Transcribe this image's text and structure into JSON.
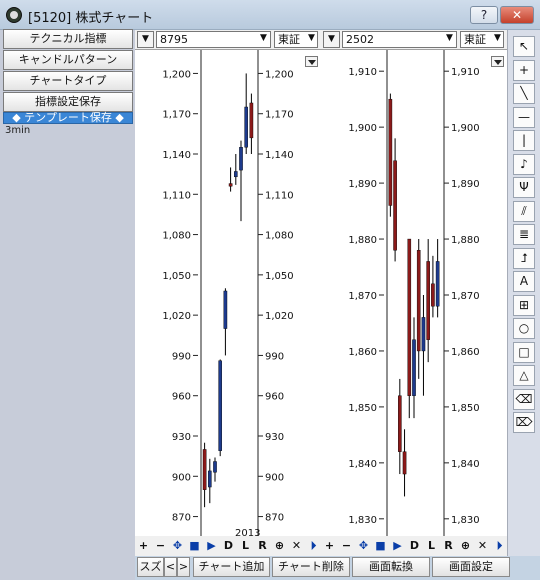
{
  "window": {
    "title": "[5120] 株式チャート",
    "help_label": "?",
    "close_label": "✕"
  },
  "left_panel": {
    "buttons": [
      "テクニカル指標",
      "キャンドルパターン",
      "チャートタイプ",
      "指標設定保存"
    ],
    "template_label": "◆ テンプレート保存 ◆",
    "interval_label": "3min"
  },
  "charts": [
    {
      "code": "8795",
      "exchange": "東証",
      "x_label": "2013",
      "y_ticks": [
        "1,200",
        "1,170",
        "1,140",
        "1,110",
        "1,080",
        "1,050",
        "1,020",
        "990",
        "960",
        "930",
        "900",
        "870"
      ],
      "ylim": [
        860,
        1210
      ],
      "candles": [
        {
          "o": 920,
          "h": 925,
          "l": 877,
          "c": 890
        },
        {
          "o": 892,
          "h": 913,
          "l": 880,
          "c": 904
        },
        {
          "o": 903,
          "h": 914,
          "l": 896,
          "c": 911
        },
        {
          "o": 919,
          "h": 987,
          "l": 915,
          "c": 986
        },
        {
          "o": 1010,
          "h": 1040,
          "l": 990,
          "c": 1038
        },
        {
          "o": 1118,
          "h": 1130,
          "l": 1112,
          "c": 1116
        },
        {
          "o": 1123,
          "h": 1140,
          "l": 1117,
          "c": 1127
        },
        {
          "o": 1128,
          "h": 1150,
          "l": 1090,
          "c": 1145
        },
        {
          "o": 1145,
          "h": 1200,
          "l": 1140,
          "c": 1175
        },
        {
          "o": 1178,
          "h": 1185,
          "l": 1140,
          "c": 1152
        }
      ]
    },
    {
      "code": "2502",
      "exchange": "東証",
      "y_ticks": [
        "1,910",
        "1,900",
        "1,890",
        "1,880",
        "1,870",
        "1,860",
        "1,850",
        "1,840",
        "1,830"
      ],
      "ylim": [
        1828,
        1912
      ],
      "candles": [
        {
          "o": 1905,
          "h": 1906,
          "l": 1884,
          "c": 1886
        },
        {
          "o": 1894,
          "h": 1898,
          "l": 1876,
          "c": 1878
        },
        {
          "o": 1852,
          "h": 1855,
          "l": 1838,
          "c": 1842
        },
        {
          "o": 1842,
          "h": 1846,
          "l": 1834,
          "c": 1838
        },
        {
          "o": 1880,
          "h": 1880,
          "l": 1848,
          "c": 1852
        },
        {
          "o": 1852,
          "h": 1866,
          "l": 1848,
          "c": 1862
        },
        {
          "o": 1878,
          "h": 1880,
          "l": 1855,
          "c": 1860
        },
        {
          "o": 1860,
          "h": 1870,
          "l": 1852,
          "c": 1866
        },
        {
          "o": 1876,
          "h": 1880,
          "l": 1858,
          "c": 1862
        },
        {
          "o": 1872,
          "h": 1877,
          "l": 1866,
          "c": 1868
        },
        {
          "o": 1868,
          "h": 1880,
          "l": 1866,
          "c": 1876
        }
      ]
    }
  ],
  "nav_buttons": [
    "+",
    "−",
    "✥",
    "■",
    "▶",
    "D",
    "L",
    "R",
    "⊕",
    "✕",
    "⏵"
  ],
  "bottom_tabs": [
    "スズ",
    "<",
    ">",
    "チャート追加",
    "チャート削除",
    "画面転換",
    "画面設定"
  ],
  "tools": [
    "↖",
    "+",
    "╲",
    "—",
    "|",
    "♪",
    "Ψ",
    "⫽",
    "≣",
    "⮥",
    "A",
    "⊞",
    "○",
    "□",
    "△",
    "⌫",
    "⌦"
  ],
  "colors": {
    "up": "#1d3a8c",
    "down": "#8b1a1a",
    "accent": "#3a86d6"
  }
}
